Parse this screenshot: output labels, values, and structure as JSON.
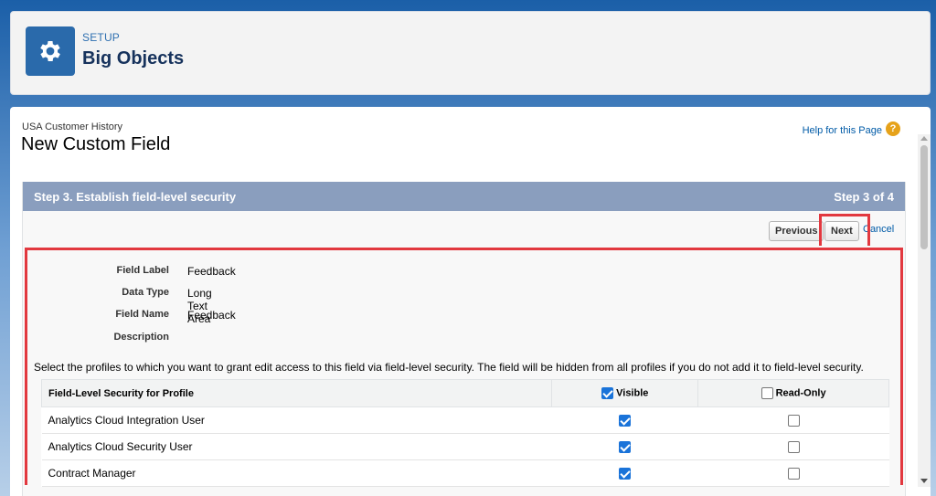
{
  "header": {
    "eyebrow": "SETUP",
    "title": "Big Objects",
    "icon": "gear-icon"
  },
  "page": {
    "breadcrumb": "USA Customer History",
    "title": "New Custom Field",
    "help_link": "Help for this Page",
    "help_icon": "?"
  },
  "step": {
    "title": "Step 3. Establish field-level security",
    "count": "Step 3 of 4"
  },
  "buttons": {
    "previous": "Previous",
    "next": "Next",
    "cancel": "Cancel"
  },
  "details": [
    {
      "label": "Field Label",
      "value": "Feedback"
    },
    {
      "label": "Data Type",
      "value": "Long Text Area"
    },
    {
      "label": "Field Name",
      "value": "Feedback"
    },
    {
      "label": "Description",
      "value": ""
    }
  ],
  "instructions": "Select the profiles to which you want to grant edit access to this field via field-level security. The field will be hidden from all profiles if you do not add it to field-level security.",
  "table": {
    "headers": {
      "profile": "Field-Level Security for Profile",
      "visible": "Visible",
      "read_only": "Read-Only"
    },
    "header_visible_checked": true,
    "header_readonly_checked": false,
    "rows": [
      {
        "profile": "Analytics Cloud Integration User",
        "visible": true,
        "read_only": false
      },
      {
        "profile": "Analytics Cloud Security User",
        "visible": true,
        "read_only": false
      },
      {
        "profile": "Contract Manager",
        "visible": true,
        "read_only": false
      }
    ]
  },
  "colors": {
    "step_bar": "#8a9ebe",
    "highlight": "#e2383f",
    "link": "#015ba7",
    "header_icon_bg": "#2a6aab"
  }
}
